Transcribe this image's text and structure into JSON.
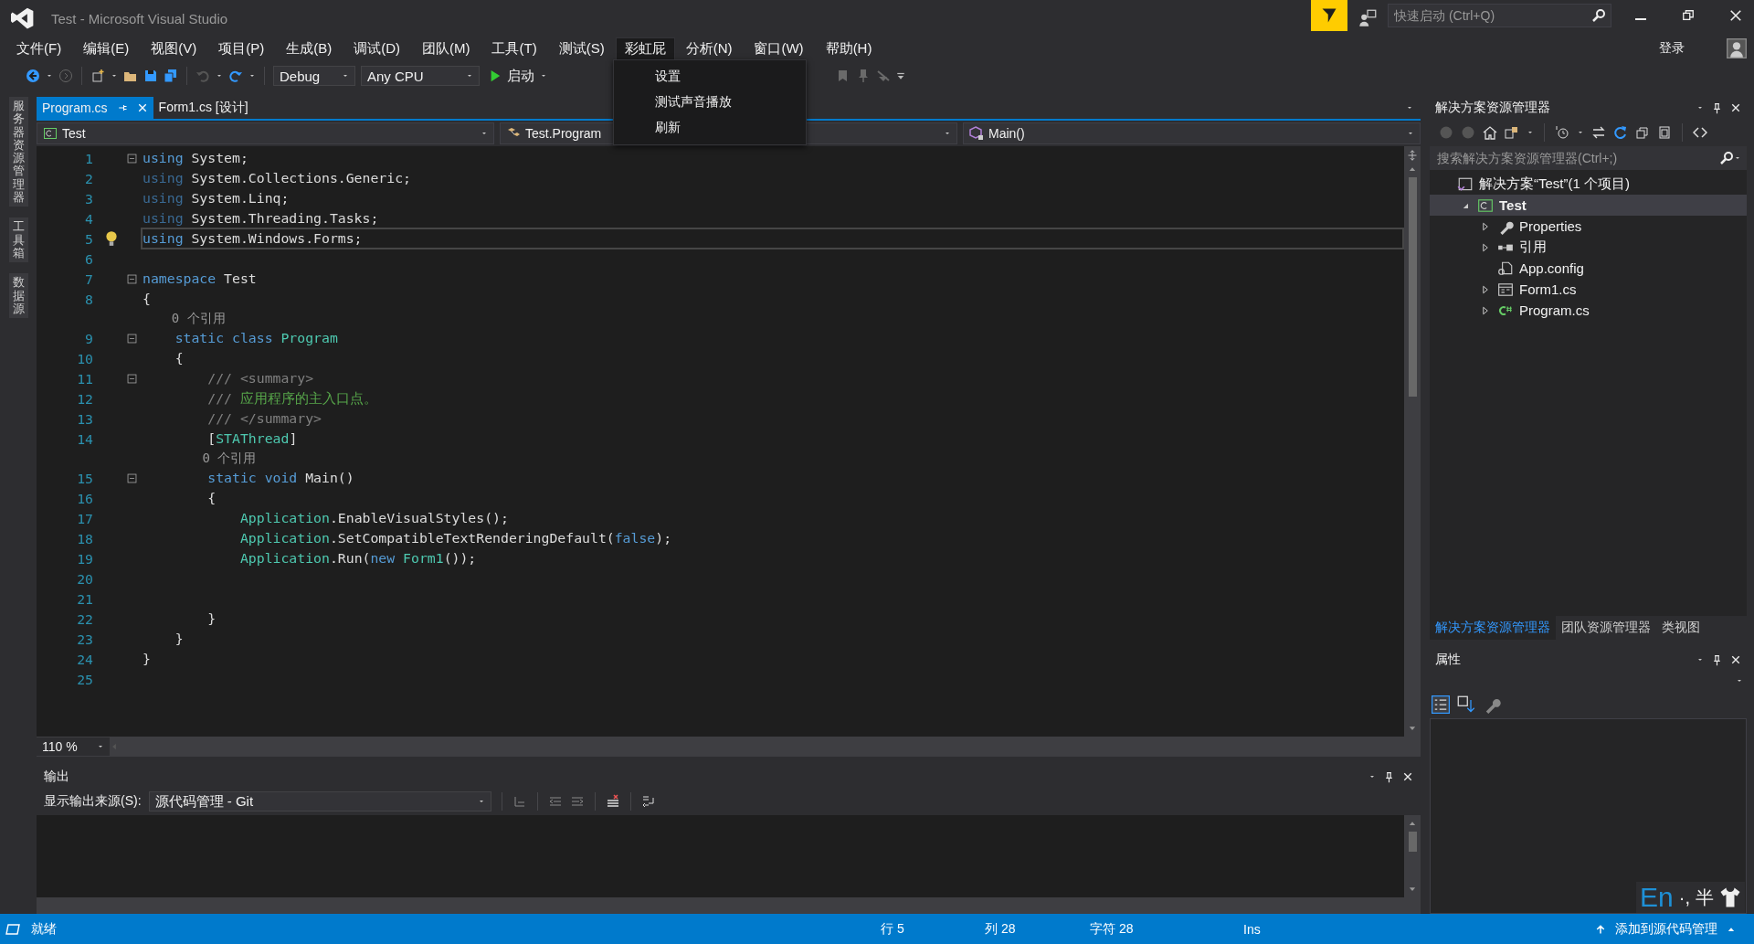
{
  "title_bar": {
    "title": "Test - Microsoft Visual Studio",
    "quick_launch": {
      "placeholder": "快速启动 (Ctrl+Q)"
    }
  },
  "menu": [
    {
      "label": "文件(F)",
      "open": false
    },
    {
      "label": "编辑(E)",
      "open": false
    },
    {
      "label": "视图(V)",
      "open": false
    },
    {
      "label": "项目(P)",
      "open": false
    },
    {
      "label": "生成(B)",
      "open": false
    },
    {
      "label": "调试(D)",
      "open": false
    },
    {
      "label": "团队(M)",
      "open": false
    },
    {
      "label": "工具(T)",
      "open": false
    },
    {
      "label": "测试(S)",
      "open": false
    },
    {
      "label": "彩虹屁",
      "open": true
    },
    {
      "label": "分析(N)",
      "open": false
    },
    {
      "label": "窗口(W)",
      "open": false
    },
    {
      "label": "帮助(H)",
      "open": false
    }
  ],
  "sign_in": "登录",
  "dropdown": [
    "设置",
    "测试声音播放",
    "刷新"
  ],
  "toolbar": {
    "configuration": "Debug",
    "platform": "Any CPU",
    "start": "启动"
  },
  "side_tabs": [
    "服务器资源管理器",
    "工具箱",
    "数据源"
  ],
  "editor_tabs": [
    {
      "label": "Program.cs",
      "selected": true
    },
    {
      "label": "Form1.cs [设计]",
      "selected": false
    }
  ],
  "nav_bar": [
    "Test",
    "Test.Program",
    "Main()"
  ],
  "code": [
    {
      "kind": "code",
      "number": "1",
      "fold": true,
      "current": false,
      "tokens": [
        {
          "kind": "kw",
          "text": "using"
        },
        {
          "kind": "plain",
          "text": " System;"
        }
      ]
    },
    {
      "kind": "code",
      "number": "2",
      "fold": false,
      "current": false,
      "tokens": [
        {
          "kind": "kw_faded",
          "text": "using"
        },
        {
          "kind": "plain",
          "text": " System.Collections.Generic;"
        }
      ]
    },
    {
      "kind": "code",
      "number": "3",
      "fold": false,
      "current": false,
      "tokens": [
        {
          "kind": "kw_faded",
          "text": "using"
        },
        {
          "kind": "plain",
          "text": " System.Linq;"
        }
      ]
    },
    {
      "kind": "code",
      "number": "4",
      "fold": false,
      "current": false,
      "tokens": [
        {
          "kind": "kw_faded",
          "text": "using"
        },
        {
          "kind": "plain",
          "text": " System.Threading.Tasks;"
        }
      ]
    },
    {
      "kind": "code",
      "number": "5",
      "fold": false,
      "current": true,
      "tokens": [
        {
          "kind": "kw",
          "text": "using"
        },
        {
          "kind": "plain",
          "text": " System.Windows.Forms;"
        }
      ]
    },
    {
      "kind": "code",
      "number": "6",
      "fold": false,
      "current": false
    },
    {
      "kind": "code",
      "number": "7",
      "fold": true,
      "current": false,
      "tokens": [
        {
          "kind": "kw",
          "text": "namespace"
        },
        {
          "kind": "plain",
          "text": " Test"
        }
      ]
    },
    {
      "kind": "code",
      "number": "8",
      "fold": false,
      "current": false,
      "tokens": [
        {
          "kind": "plain",
          "text": "{"
        }
      ]
    },
    {
      "kind": "lens",
      "text": "    0 个引用"
    },
    {
      "kind": "code",
      "number": "9",
      "fold": true,
      "current": false,
      "tokens": [
        {
          "kind": "kw",
          "text": "    static class"
        },
        {
          "kind": "type",
          "text": " Program"
        }
      ]
    },
    {
      "kind": "code",
      "number": "10",
      "fold": false,
      "current": false,
      "tokens": [
        {
          "kind": "plain",
          "text": "    {"
        }
      ]
    },
    {
      "kind": "code",
      "number": "11",
      "fold": true,
      "current": false,
      "tokens": [
        {
          "kind": "doc",
          "text": "        /// <summary>"
        }
      ]
    },
    {
      "kind": "code",
      "number": "12",
      "fold": false,
      "current": false,
      "tokens": [
        {
          "kind": "doc",
          "text": "        ///"
        },
        {
          "kind": "comment",
          "text": " 应用程序的主入口点。"
        }
      ]
    },
    {
      "kind": "code",
      "number": "13",
      "fold": false,
      "current": false,
      "tokens": [
        {
          "kind": "doc",
          "text": "        /// </summary>"
        }
      ]
    },
    {
      "kind": "code",
      "number": "14",
      "fold": false,
      "current": false,
      "tokens": [
        {
          "kind": "plain",
          "text": "        ["
        },
        {
          "kind": "type",
          "text": "STAThread"
        },
        {
          "kind": "plain",
          "text": "]"
        }
      ]
    },
    {
      "kind": "lens",
      "text": "        0 个引用"
    },
    {
      "kind": "code",
      "number": "15",
      "fold": true,
      "current": false,
      "tokens": [
        {
          "kind": "kw",
          "text": "        static void"
        },
        {
          "kind": "plain",
          "text": " Main()"
        }
      ]
    },
    {
      "kind": "code",
      "number": "16",
      "fold": false,
      "current": false,
      "tokens": [
        {
          "kind": "plain",
          "text": "        {"
        }
      ]
    },
    {
      "kind": "code",
      "number": "17",
      "fold": false,
      "current": false,
      "tokens": [
        {
          "kind": "type",
          "text": "            Application"
        },
        {
          "kind": "plain",
          "text": ".EnableVisualStyles();"
        }
      ]
    },
    {
      "kind": "code",
      "number": "18",
      "fold": false,
      "current": false,
      "tokens": [
        {
          "kind": "type",
          "text": "            Application"
        },
        {
          "kind": "plain",
          "text": ".SetCompatibleTextRenderingDefault("
        },
        {
          "kind": "kw",
          "text": "false"
        },
        {
          "kind": "plain",
          "text": ");"
        }
      ]
    },
    {
      "kind": "code",
      "number": "19",
      "fold": false,
      "current": false,
      "tokens": [
        {
          "kind": "type",
          "text": "            Application"
        },
        {
          "kind": "plain",
          "text": ".Run("
        },
        {
          "kind": "kw",
          "text": "new"
        },
        {
          "kind": "type",
          "text": " Form1"
        },
        {
          "kind": "plain",
          "text": "());"
        }
      ]
    },
    {
      "kind": "code",
      "number": "20",
      "fold": false,
      "current": false
    },
    {
      "kind": "code",
      "number": "21",
      "fold": false,
      "current": false
    },
    {
      "kind": "code",
      "number": "22",
      "fold": false,
      "current": false,
      "tokens": [
        {
          "kind": "plain",
          "text": "        }"
        }
      ]
    },
    {
      "kind": "code",
      "number": "23",
      "fold": false,
      "current": false,
      "tokens": [
        {
          "kind": "plain",
          "text": "    }"
        }
      ]
    },
    {
      "kind": "code",
      "number": "24",
      "fold": false,
      "current": false,
      "tokens": [
        {
          "kind": "plain",
          "text": "}"
        }
      ]
    },
    {
      "kind": "code",
      "number": "25",
      "fold": false,
      "current": false
    }
  ],
  "zoom": "110 %",
  "output": {
    "title": "输出",
    "source_label": "显示输出来源(S):",
    "source": "源代码管理 - Git"
  },
  "solution_explorer": {
    "title": "解决方案资源管理器",
    "search": {
      "placeholder": "搜索解决方案资源管理器(Ctrl+;)"
    },
    "tree": [
      {
        "label": "解决方案“Test”(1 个项目)",
        "kind": "solution",
        "selected": false,
        "children": [
          {
            "label": "Test",
            "kind": "project",
            "expanded": true,
            "selected": true,
            "children": [
              {
                "label": "Properties",
                "kind": "properties",
                "expanded": false,
                "selected": false
              },
              {
                "label": "引用",
                "kind": "references",
                "expanded": false,
                "selected": false
              },
              {
                "label": "App.config",
                "kind": "config",
                "selected": false
              },
              {
                "label": "Form1.cs",
                "kind": "form",
                "expanded": false,
                "selected": false
              },
              {
                "label": "Program.cs",
                "kind": "csharp",
                "expanded": false,
                "selected": false
              }
            ]
          }
        ]
      }
    ]
  },
  "panel_tabs": [
    {
      "label": "解决方案资源管理器",
      "selected": true
    },
    {
      "label": "团队资源管理器",
      "selected": false
    },
    {
      "label": "类视图",
      "selected": false
    }
  ],
  "properties": {
    "title": "属性"
  },
  "ime": {
    "language": "En",
    "punctuation": "·,",
    "width": "半"
  },
  "status_bar": {
    "message": "就绪",
    "line": "行 5",
    "column": "列 28",
    "char": "字符 28",
    "mode": "Ins",
    "source_control": "添加到源代码管理"
  }
}
